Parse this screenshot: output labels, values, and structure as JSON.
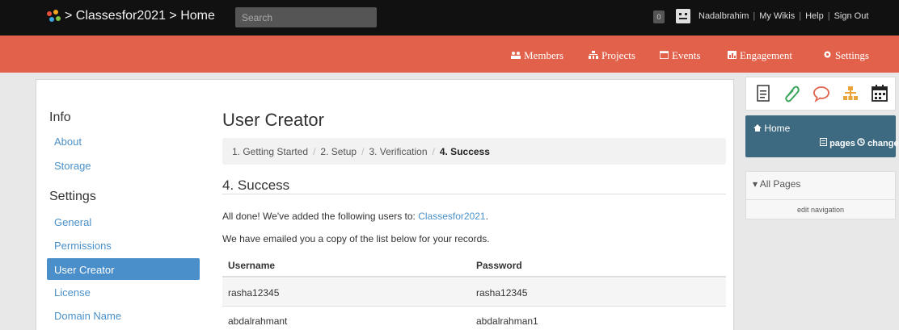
{
  "topbar": {
    "breadcrumb": "> Classesfor2021 > Home",
    "search_placeholder": "Search",
    "notification_count": "0",
    "links": [
      "Nadalbrahim",
      "My Wikis",
      "Help",
      "Sign Out"
    ],
    "logo_colors": [
      "#e94f3c",
      "#f5a623",
      "#3aa7e0",
      "#7dc242"
    ]
  },
  "nav": {
    "items": [
      {
        "label": "Members",
        "icon": "members-icon"
      },
      {
        "label": "Projects",
        "icon": "projects-icon"
      },
      {
        "label": "Events",
        "icon": "calendar-icon"
      },
      {
        "label": "Engagement",
        "icon": "chart-icon"
      },
      {
        "label": "Settings",
        "icon": "gear-icon"
      }
    ],
    "color": "#e2614b"
  },
  "sidebar": {
    "info_heading": "Info",
    "info_links": [
      "About",
      "Storage"
    ],
    "settings_heading": "Settings",
    "settings_links": [
      "General",
      "Permissions",
      "User Creator",
      "License",
      "Domain Name"
    ],
    "active": "User Creator"
  },
  "main": {
    "title": "User Creator",
    "steps": [
      "1. Getting Started",
      "2. Setup",
      "3. Verification",
      "4. Success"
    ],
    "section_title": "4. Success",
    "done_text": "All done! We've added the following users to: ",
    "wiki_link": "Classesfor2021",
    "done_suffix": ".",
    "email_text": "We have emailed you a copy of the list below for your records.",
    "table": {
      "headers": [
        "Username",
        "Password"
      ],
      "rows": [
        [
          "rasha12345",
          "rasha12345"
        ],
        [
          "abdalrahmant",
          "abdalrahman1"
        ]
      ]
    }
  },
  "right": {
    "tools": [
      "page-icon",
      "paperclip-icon",
      "comment-icon",
      "sitemap-icon",
      "calendar-icon"
    ],
    "home_title": "Home",
    "home_pages": "pages",
    "home_changes": "changes",
    "all_pages": "All Pages",
    "edit_navigation": "edit navigation"
  }
}
